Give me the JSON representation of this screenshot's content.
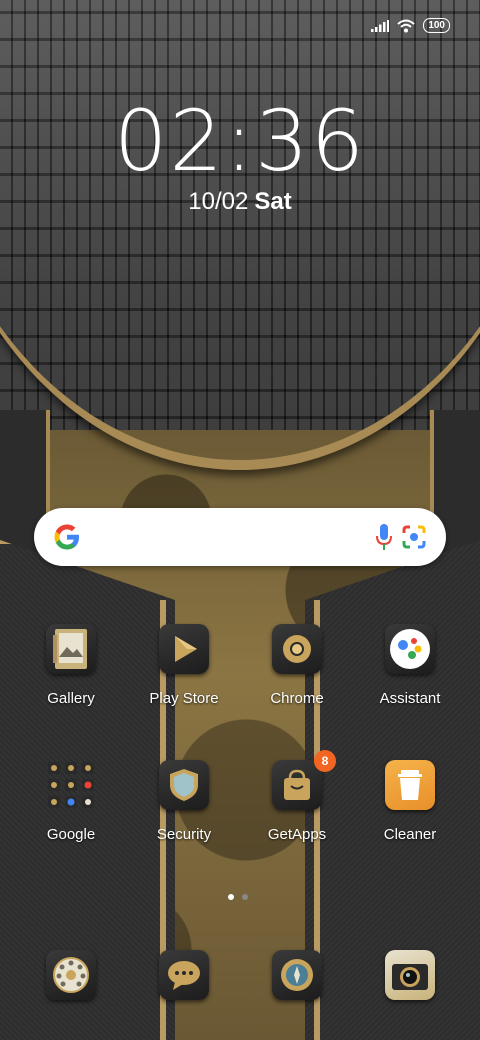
{
  "status_bar": {
    "battery": "100"
  },
  "clock": {
    "time": "02:36",
    "date": "10/02",
    "day": "Sat"
  },
  "search": {
    "placeholder": ""
  },
  "apps": [
    {
      "label": "Gallery",
      "icon": "gallery-icon"
    },
    {
      "label": "Play Store",
      "icon": "play-store-icon"
    },
    {
      "label": "Chrome",
      "icon": "chrome-icon"
    },
    {
      "label": "Assistant",
      "icon": "assistant-icon"
    },
    {
      "label": "Google",
      "icon": "google-folder-icon"
    },
    {
      "label": "Security",
      "icon": "security-icon"
    },
    {
      "label": "GetApps",
      "icon": "getapps-icon",
      "badge": "8"
    },
    {
      "label": "Cleaner",
      "icon": "cleaner-icon"
    }
  ],
  "dock": [
    {
      "icon": "phone-dialer-icon"
    },
    {
      "icon": "messages-icon"
    },
    {
      "icon": "compass-icon"
    },
    {
      "icon": "camera-icon"
    }
  ],
  "page_indicator": {
    "pages": 2,
    "current": 1
  }
}
